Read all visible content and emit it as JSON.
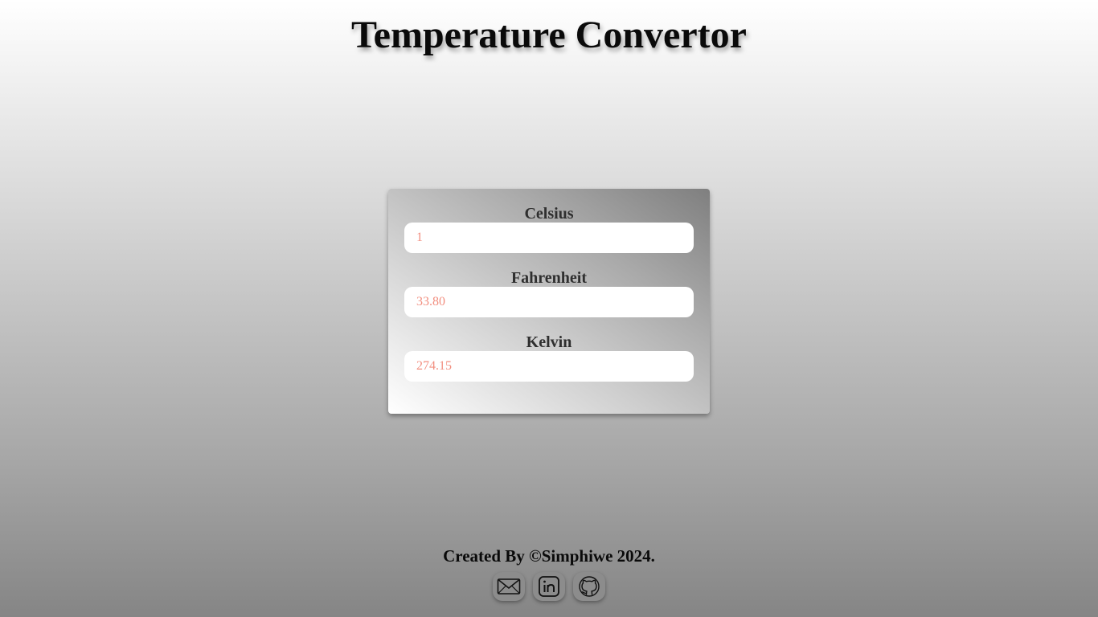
{
  "page": {
    "title": "Temperature Convertor"
  },
  "converter": {
    "fields": [
      {
        "label": "Celsius",
        "value": "1"
      },
      {
        "label": "Fahrenheit",
        "value": "33.80"
      },
      {
        "label": "Kelvin",
        "value": "274.15"
      }
    ]
  },
  "footer": {
    "credit": "Created By ©Simphiwe 2024.",
    "links": [
      {
        "icon": "mail-icon"
      },
      {
        "icon": "linkedin-icon"
      },
      {
        "icon": "github-icon"
      }
    ]
  },
  "colors": {
    "input_text": "#f28f80",
    "label_text": "#2f2f2f",
    "icon_button": "#8c8c8c"
  }
}
